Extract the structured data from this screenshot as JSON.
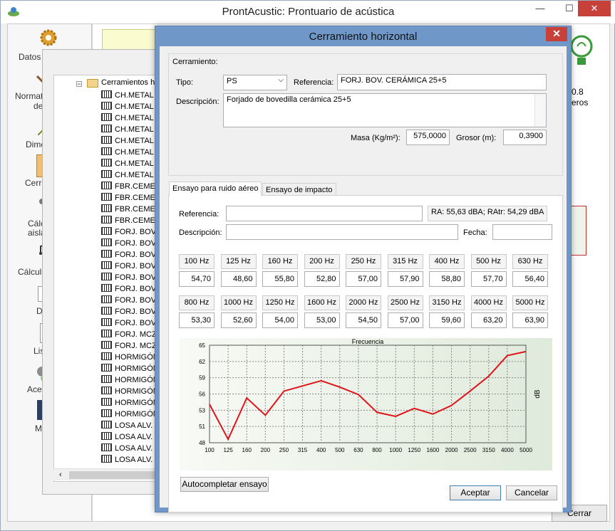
{
  "app": {
    "title": "ProntAcustic: Prontuario de acústica",
    "minimize": "—",
    "maximize": "☐",
    "close": "✕"
  },
  "nav": [
    {
      "label": "Datos"
    },
    {
      "label": "Normat"
    },
    {
      "label": "de"
    },
    {
      "label": "Dime"
    },
    {
      "label": "Cerra"
    },
    {
      "label": "Cálc"
    },
    {
      "label": "aisla"
    },
    {
      "label": "Cálculo"
    },
    {
      "label": "D"
    },
    {
      "label": "Lis"
    },
    {
      "label": "Acer"
    },
    {
      "label": "M"
    }
  ],
  "background": {
    "right_value": "0.8",
    "right_label": "eros",
    "close_button": "Cerrar"
  },
  "tree": {
    "root": "Cerramientos ho",
    "items": [
      "CH.METAL",
      "CH.METAL",
      "CH.METAL",
      "CH.METAL",
      "CH.METAL",
      "CH.METAL",
      "CH.METAL",
      "CH.METAL",
      "FBR.CEMEN",
      "FBR.CEMEN",
      "FBR.CEMEN",
      "FBR.CEMEN",
      "FORJ. BOV.",
      "FORJ. BOV.",
      "FORJ. BOV.",
      "FORJ. BOV.",
      "FORJ. BOV.",
      "FORJ. BOV.",
      "FORJ. BOV.",
      "FORJ. BOV.",
      "FORJ. BOV.",
      "FORJ. MCZO",
      "FORJ. MCZO",
      "HORMIGÓN",
      "HORMIGÓN",
      "HORMIGÓN",
      "HORMIGÓN",
      "HORMIGÓN",
      "HORMIGÓN",
      "LOSA ALV.",
      "LOSA ALV.",
      "LOSA ALV.",
      "LOSA ALV."
    ]
  },
  "dialog": {
    "title": "Cerramiento horizontal",
    "close": "✕",
    "group_label": "Cerramiento:",
    "tipo_label": "Tipo:",
    "tipo_value": "PS",
    "referencia_label": "Referencia:",
    "referencia_value": "FORJ. BOV. CERÁMICA 25+5",
    "descripcion_label": "Descripción:",
    "descripcion_value": "Forjado de bovedilla cerámica 25+5",
    "masa_label": "Masa (Kg/m²):",
    "masa_value": "575,0000",
    "grosor_label": "Grosor (m):",
    "grosor_value": "0,3900",
    "tabs": [
      {
        "label": "Ensayo para ruido aéreo"
      },
      {
        "label": "Ensayo de impacto"
      }
    ],
    "ensayo": {
      "referencia_label": "Referencia:",
      "referencia_value": "",
      "ra_text": "RA: 55,63 dBA; RAtr: 54,29 dBA",
      "descripcion_label": "Descripción:",
      "descripcion_value": "",
      "fecha_label": "Fecha:",
      "fecha_value": ""
    },
    "freq_row1": [
      {
        "f": "100 Hz",
        "v": "54,70"
      },
      {
        "f": "125 Hz",
        "v": "48,60"
      },
      {
        "f": "160 Hz",
        "v": "55,80"
      },
      {
        "f": "200 Hz",
        "v": "52,80"
      },
      {
        "f": "250 Hz",
        "v": "57,00"
      },
      {
        "f": "315 Hz",
        "v": "57,90"
      },
      {
        "f": "400 Hz",
        "v": "58,80"
      },
      {
        "f": "500 Hz",
        "v": "57,70"
      },
      {
        "f": "630 Hz",
        "v": "56,40"
      }
    ],
    "freq_row2": [
      {
        "f": "800 Hz",
        "v": "53,30"
      },
      {
        "f": "1000 Hz",
        "v": "52,60"
      },
      {
        "f": "1250 Hz",
        "v": "54,00"
      },
      {
        "f": "1600 Hz",
        "v": "53,00"
      },
      {
        "f": "2000 Hz",
        "v": "54,50"
      },
      {
        "f": "2500 Hz",
        "v": "57,00"
      },
      {
        "f": "3150 Hz",
        "v": "59,60"
      },
      {
        "f": "4000 Hz",
        "v": "63,20"
      },
      {
        "f": "5000 Hz",
        "v": "63,90"
      }
    ],
    "autocompletar": "Autocompletar ensayo",
    "aceptar": "Aceptar",
    "cancelar": "Cancelar"
  },
  "chart_data": {
    "type": "line",
    "title": "Frecuencia",
    "xlabel": "",
    "ylabel": "dB",
    "categories": [
      "100",
      "125",
      "160",
      "200",
      "250",
      "315",
      "400",
      "500",
      "630",
      "800",
      "1000",
      "1250",
      "1600",
      "2000",
      "2500",
      "3150",
      "4000",
      "5000"
    ],
    "series": [
      {
        "values": [
          54.7,
          48.6,
          55.8,
          52.8,
          57.0,
          57.9,
          58.8,
          57.7,
          56.4,
          53.3,
          52.6,
          54.0,
          53.0,
          54.5,
          57.0,
          59.6,
          63.2,
          63.9
        ]
      }
    ],
    "ylim": [
      48,
      65
    ],
    "yticks": [
      "48",
      "51",
      "53",
      "56",
      "59",
      "62",
      "65"
    ],
    "grid": true,
    "color": "#e0141b"
  }
}
